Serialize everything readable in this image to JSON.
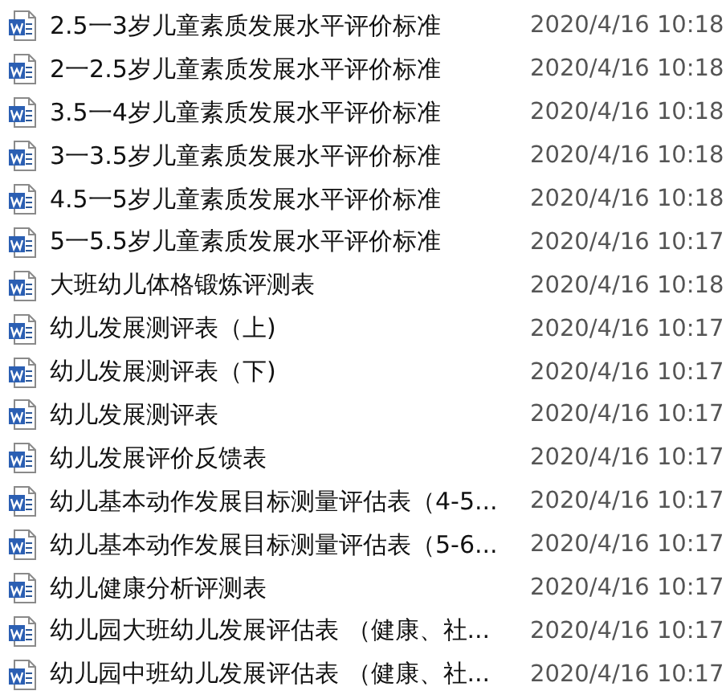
{
  "files": [
    {
      "name": "2.5一3岁儿童素质发展水平评价标准",
      "modified": "2020/4/16 10:18"
    },
    {
      "name": "2一2.5岁儿童素质发展水平评价标准",
      "modified": "2020/4/16 10:18"
    },
    {
      "name": "3.5一4岁儿童素质发展水平评价标准",
      "modified": "2020/4/16 10:18"
    },
    {
      "name": "3一3.5岁儿童素质发展水平评价标准",
      "modified": "2020/4/16 10:18"
    },
    {
      "name": "4.5一5岁儿童素质发展水平评价标准",
      "modified": "2020/4/16 10:18"
    },
    {
      "name": "5一5.5岁儿童素质发展水平评价标准",
      "modified": "2020/4/16 10:17"
    },
    {
      "name": "大班幼儿体格锻炼评测表",
      "modified": "2020/4/16 10:18"
    },
    {
      "name": "幼儿发展测评表（上)",
      "modified": "2020/4/16 10:17"
    },
    {
      "name": "幼儿发展测评表（下)",
      "modified": "2020/4/16 10:17"
    },
    {
      "name": "幼儿发展测评表",
      "modified": "2020/4/16 10:17"
    },
    {
      "name": "幼儿发展评价反馈表",
      "modified": "2020/4/16 10:17"
    },
    {
      "name": "幼儿基本动作发展目标测量评估表（4-5...",
      "modified": "2020/4/16 10:17"
    },
    {
      "name": "幼儿基本动作发展目标测量评估表（5-6...",
      "modified": "2020/4/16 10:17"
    },
    {
      "name": "幼儿健康分析评测表",
      "modified": "2020/4/16 10:17"
    },
    {
      "name": "幼儿园大班幼儿发展评估表 （健康、社...",
      "modified": "2020/4/16 10:17"
    },
    {
      "name": "幼儿园中班幼儿发展评估表 （健康、社...",
      "modified": "2020/4/16 10:17"
    }
  ]
}
